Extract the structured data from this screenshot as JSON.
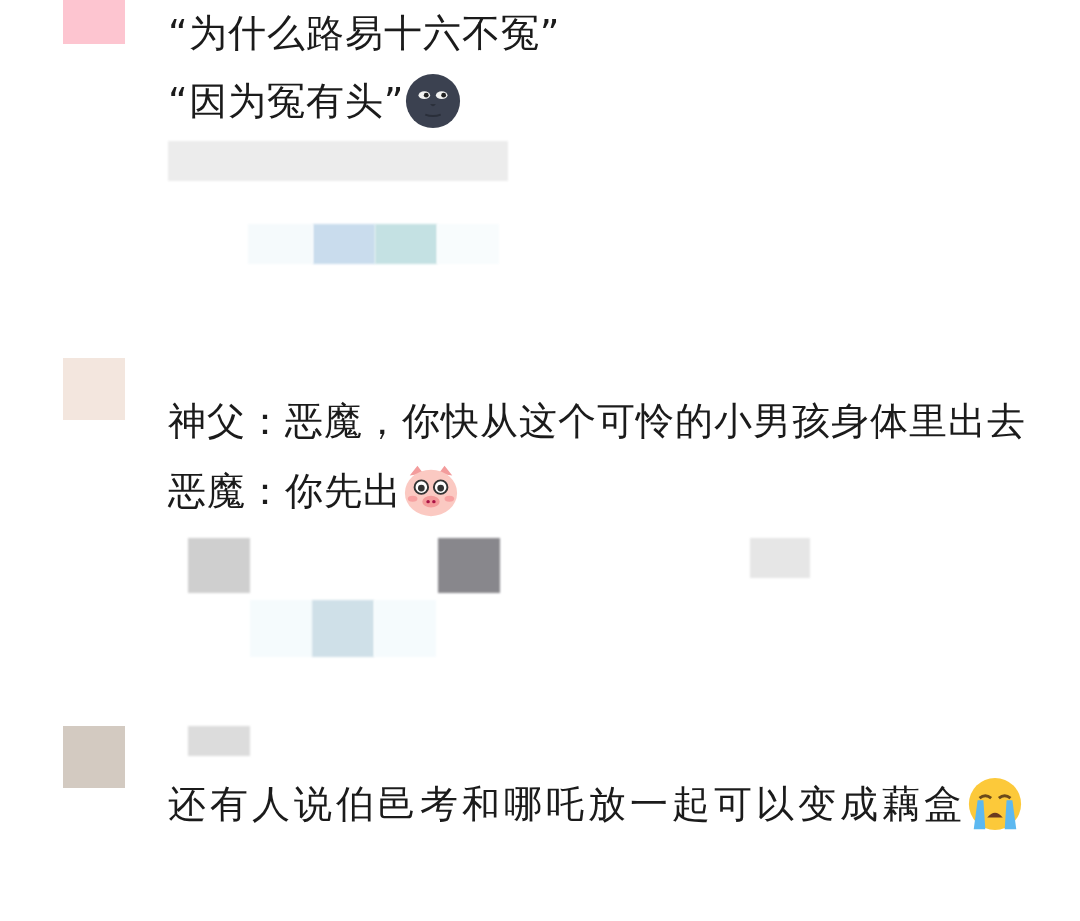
{
  "comments": [
    {
      "color": "#fdc5d0",
      "lines": [
        "“为什么路易十六不冤”",
        "“因为冤有头”"
      ],
      "kind": "moon"
    },
    {
      "color": "#f3e6de",
      "lines": [
        "神父：恶魔，你快从这个可怜的小男孩身体里出去",
        "恶魔：你先出"
      ],
      "kind": "pig"
    },
    {
      "color": "#d3cac1",
      "lines": [
        "还有人说伯邑考和哪吒放一起可以变成藕盒"
      ],
      "kind": "crying"
    }
  ]
}
